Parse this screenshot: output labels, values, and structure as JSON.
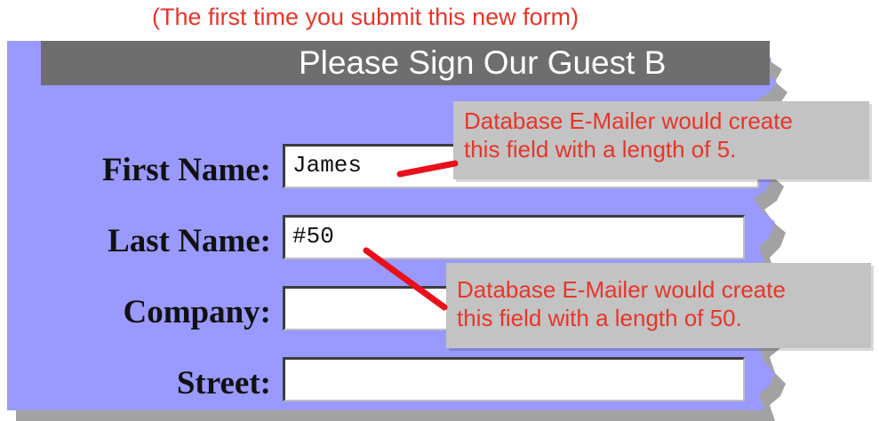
{
  "caption": "(The first time you submit this new form)",
  "form": {
    "title": "Please Sign Our Guest B",
    "panel_color": "#9999ff",
    "fields": [
      {
        "label": "First Name:",
        "value": "James"
      },
      {
        "label": "Last Name:",
        "value": "#50"
      },
      {
        "label": "Company:",
        "value": ""
      },
      {
        "label": "Street:",
        "value": ""
      }
    ]
  },
  "callouts": [
    {
      "line1": "Database E-Mailer would create",
      "line2": "this field with a length of 5."
    },
    {
      "line1": "Database E-Mailer would create",
      "line2": "this field with a length of 50."
    }
  ],
  "colors": {
    "caption_text": "#e8352a",
    "callout_bg": "#c3c3c3",
    "pointer_line": "#e8101a",
    "title_bar": "#6e6e6e"
  }
}
